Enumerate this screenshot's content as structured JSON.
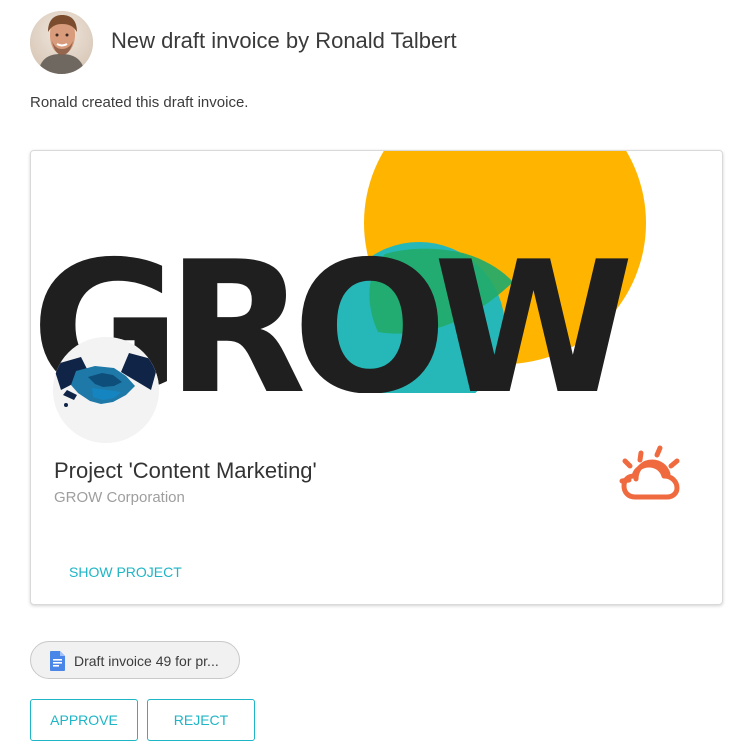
{
  "header": {
    "title": "New draft invoice by Ronald Talbert",
    "avatar_alt": "Ronald Talbert avatar"
  },
  "message": {
    "text": "Ronald created this draft invoice."
  },
  "project_card": {
    "banner_word": "GROW",
    "title": "Project 'Content Marketing'",
    "subtitle": "GROW Corporation",
    "show_project_label": "SHOW PROJECT",
    "logo_icon": "handshake-icon",
    "status_icon": "partly-cloudy-icon"
  },
  "attachment": {
    "label": "Draft invoice 49 for pr...",
    "icon": "document-icon"
  },
  "actions": {
    "approve_label": "APPROVE",
    "reject_label": "REJECT"
  },
  "colors": {
    "accent": "#1eb5c6",
    "weather_icon": "#f06a3f",
    "grow_text": "#1f1f1f",
    "grow_yellow": "#ffb400",
    "grow_teal": "#26b8b8",
    "grow_overlap": "#22aa6b"
  }
}
